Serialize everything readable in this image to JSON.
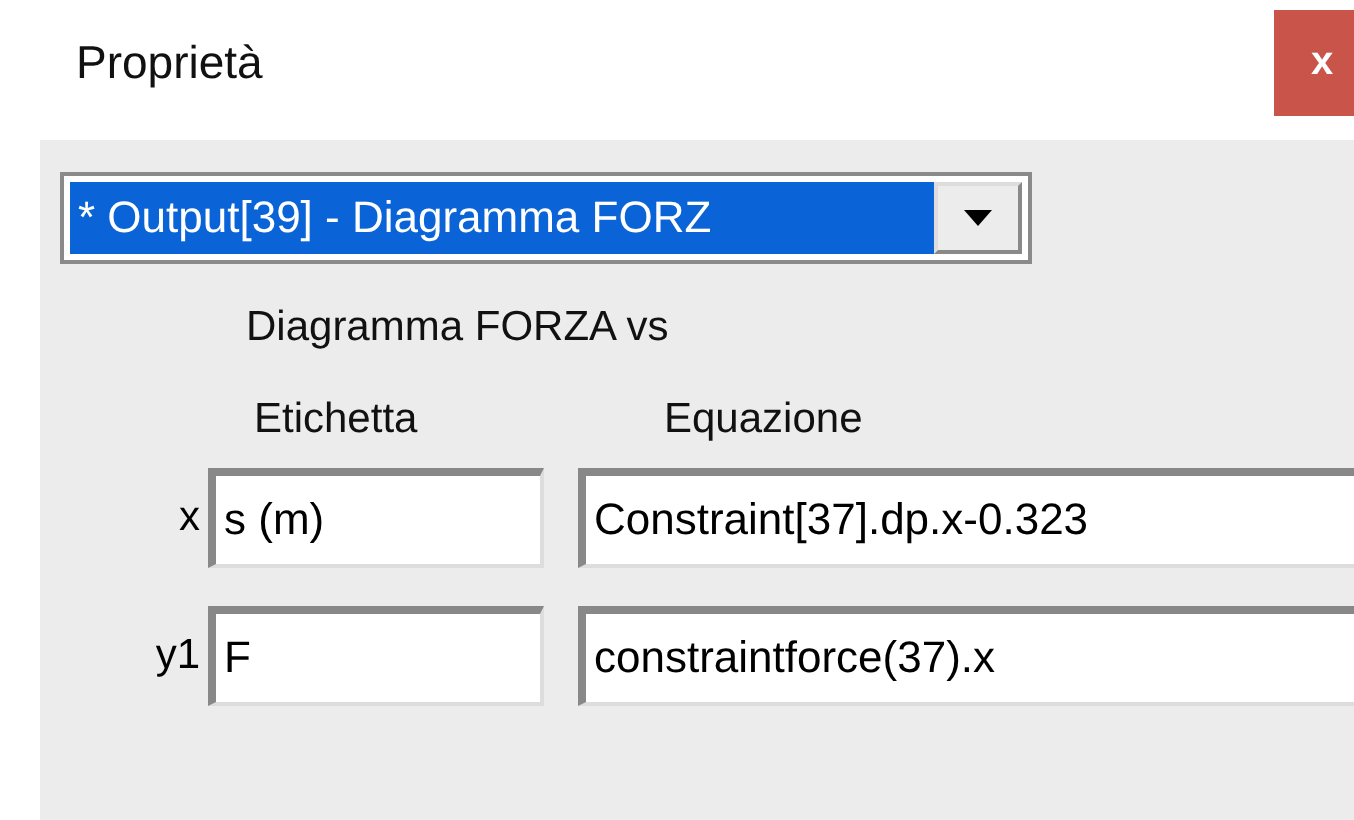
{
  "window": {
    "title": "Proprietà",
    "close": "x"
  },
  "selector": {
    "value": "* Output[39] - Diagramma FORZ",
    "selected": true
  },
  "subtitle": "Diagramma FORZA vs",
  "headers": [
    "Etichetta",
    "Equazione"
  ],
  "rows": [
    {
      "axis": "x",
      "label": "s (m)",
      "equation": "Constraint[37].dp.x-0.323"
    },
    {
      "axis": "y1",
      "label": "F",
      "equation": "constraintforce(37).x"
    }
  ]
}
